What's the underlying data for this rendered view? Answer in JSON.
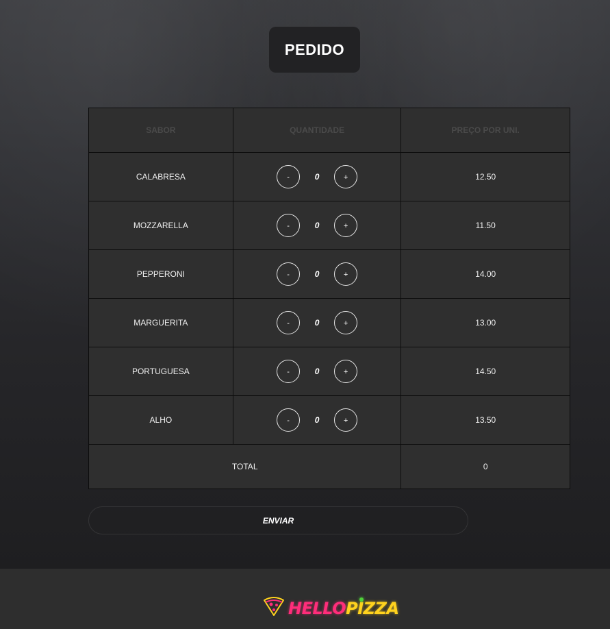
{
  "page": {
    "title": "PEDIDO"
  },
  "table": {
    "headers": [
      "SABOR",
      "QUANTIDADE",
      "PREÇO POR UNI."
    ],
    "rows": [
      {
        "flavor": "CALABRESA",
        "qty": "0",
        "price": "12.50"
      },
      {
        "flavor": "MOZZARELLA",
        "qty": "0",
        "price": "11.50"
      },
      {
        "flavor": "PEPPERONI",
        "qty": "0",
        "price": "14.00"
      },
      {
        "flavor": "MARGUERITA",
        "qty": "0",
        "price": "13.00"
      },
      {
        "flavor": "PORTUGUESA",
        "qty": "0",
        "price": "14.50"
      },
      {
        "flavor": "ALHO",
        "qty": "0",
        "price": "13.50"
      }
    ],
    "decrement_label": "-",
    "increment_label": "+",
    "total_label": "TOTAL",
    "total_value": "0"
  },
  "actions": {
    "send_label": "ENVIAR"
  },
  "footer": {
    "logo_hello": "HELLO",
    "logo_pizza": "PIZZA",
    "logo_icon": "pizza-slice-icon"
  },
  "colors": {
    "logo_pink": "#ff2d7a",
    "logo_yellow": "#ffd21e",
    "logo_green": "#4fd13a"
  }
}
